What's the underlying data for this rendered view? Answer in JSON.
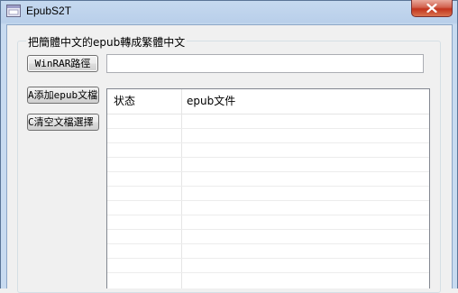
{
  "window": {
    "title": "EpubS2T"
  },
  "group": {
    "title": "把簡體中文的epub轉成繁體中文"
  },
  "buttons": {
    "winrar_label": "WinRAR路徑",
    "add_label": "A添加epub文檔",
    "clear_label": "C清空文檔選擇"
  },
  "path_input": {
    "value": ""
  },
  "listview": {
    "columns": [
      "状态",
      "epub文件"
    ]
  },
  "colors": {
    "close_button": "#c2331d",
    "titlebar": "#b9cfea"
  }
}
